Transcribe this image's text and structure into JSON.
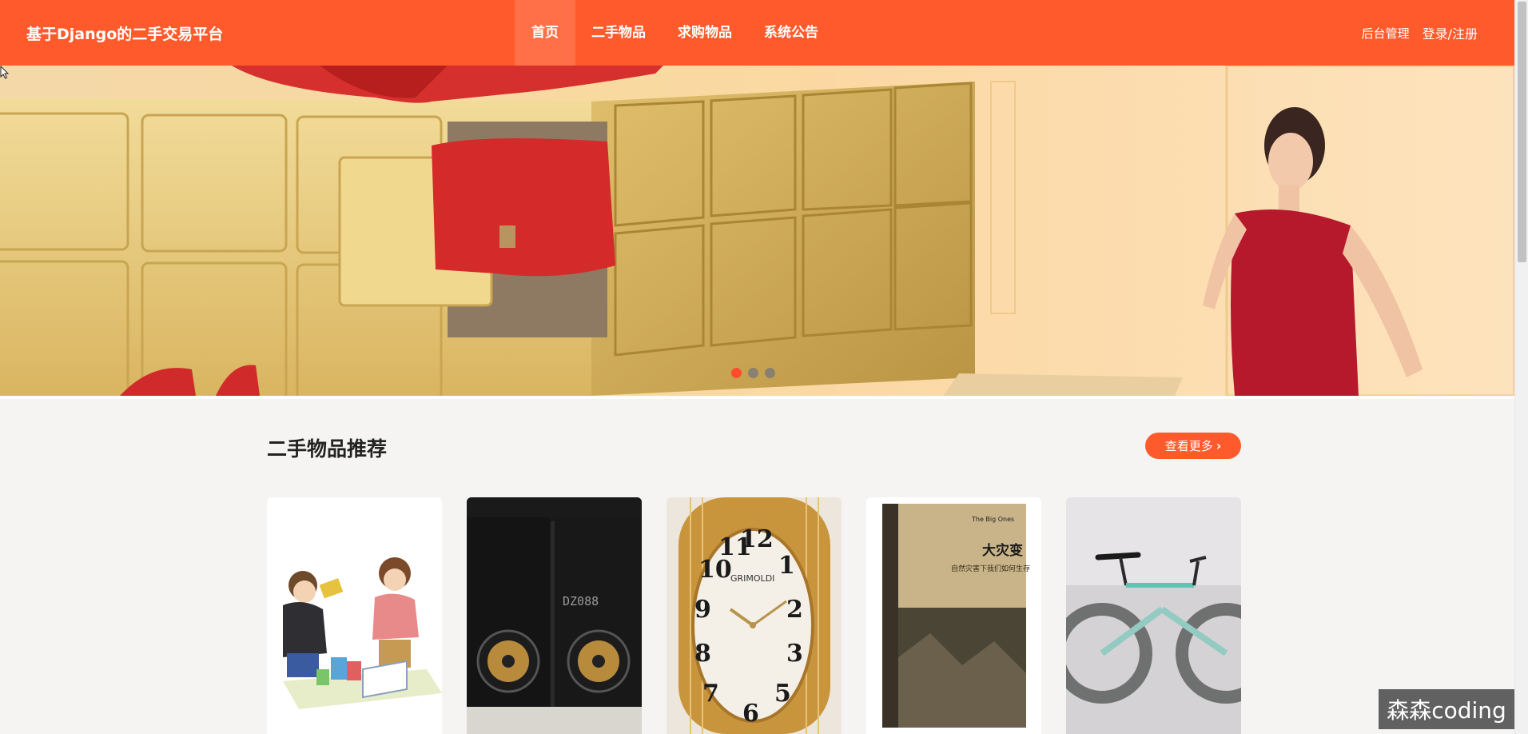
{
  "header": {
    "logo": "基于Django的二手交易平台",
    "nav": [
      {
        "label": "首页",
        "active": true
      },
      {
        "label": "二手物品",
        "active": false
      },
      {
        "label": "求购物品",
        "active": false
      },
      {
        "label": "系统公告",
        "active": false
      }
    ],
    "admin_label": "后台管理",
    "login_label": "登录/注册"
  },
  "banner": {
    "slides": 3,
    "active_slide": 1
  },
  "section": {
    "title": "二手物品推荐",
    "more_label": "查看更多"
  },
  "products": [
    {
      "image": "people-trading-books-illustration"
    },
    {
      "image": "black-speakers",
      "text": "DZ088"
    },
    {
      "image": "gold-wristwatch",
      "text": "GRIMOLDI"
    },
    {
      "image": "book-cover",
      "title": "大灾变",
      "subtitle": "自然灾害下我们如何生存",
      "en_title": "The Big Ones"
    },
    {
      "image": "bicycle"
    }
  ],
  "watermark": "森森coding",
  "colors": {
    "brand": "#ff5a2c",
    "active_nav": "#ff6f48",
    "background": "#f5f4f2"
  }
}
